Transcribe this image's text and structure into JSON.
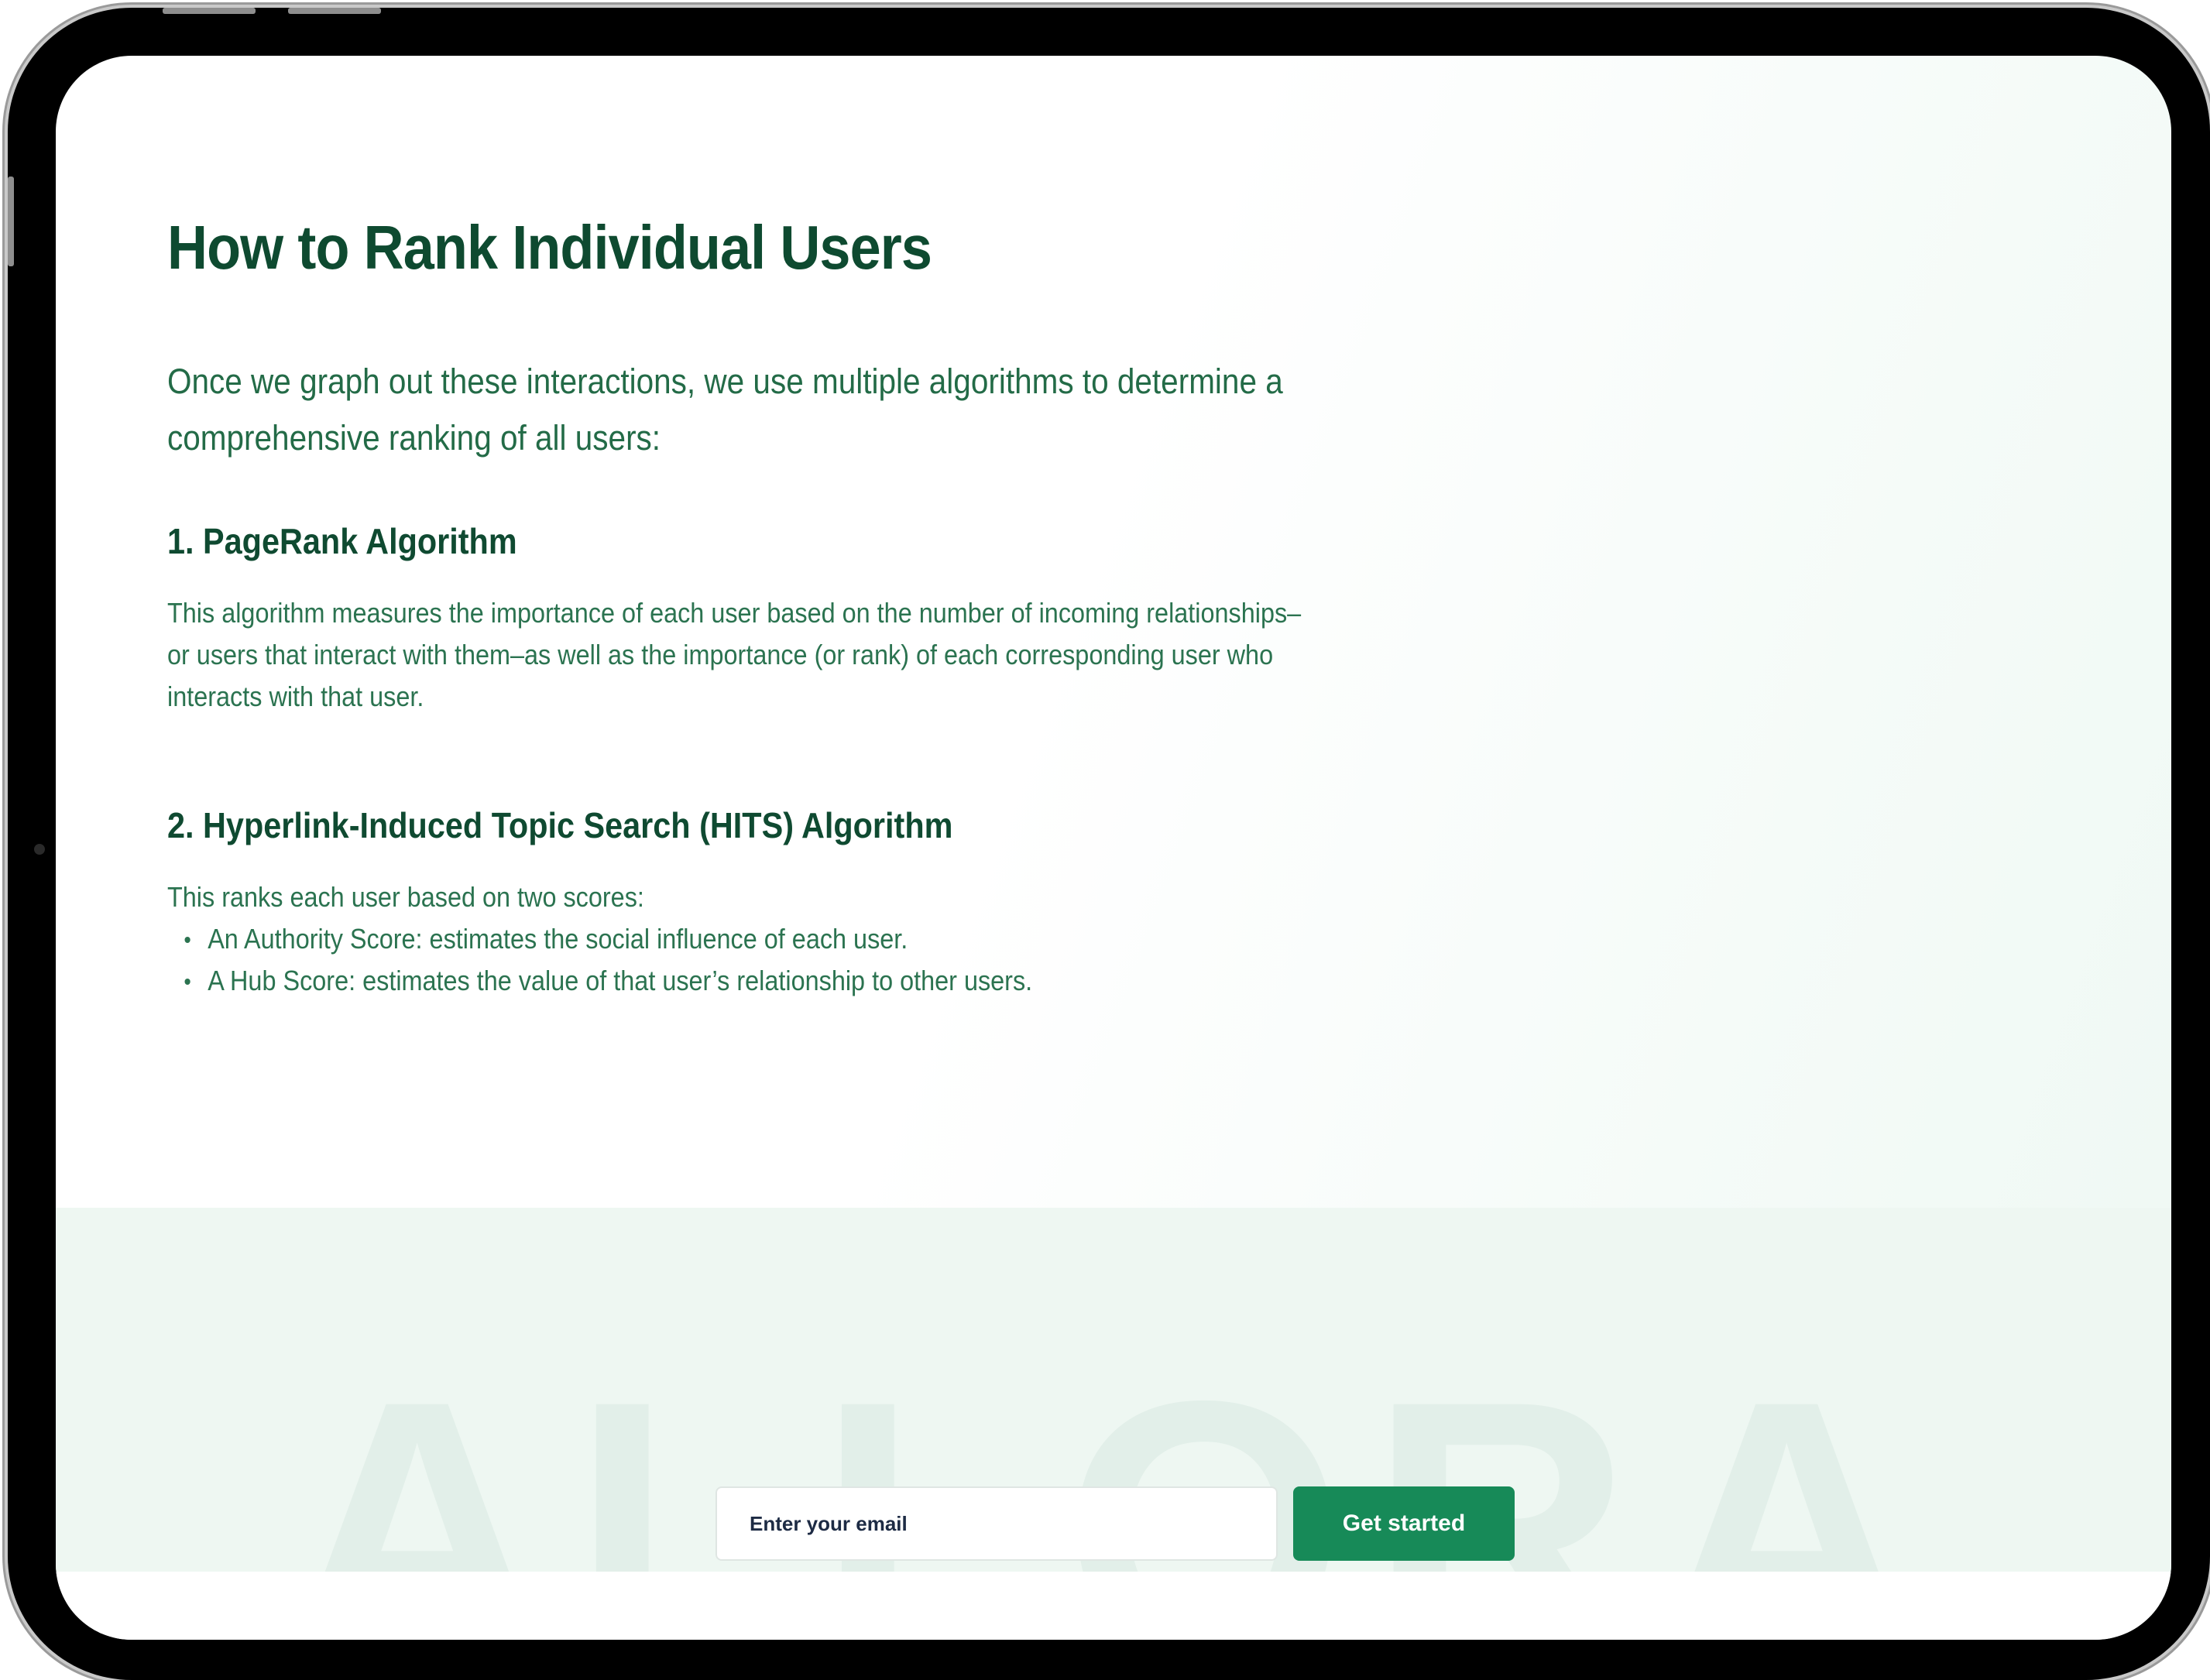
{
  "page": {
    "title": "How to Rank Individual Users",
    "lead": "Once we graph out these interactions, we use multiple algorithms to determine a comprehensive ranking of all users:"
  },
  "sections": [
    {
      "title": "1. PageRank Algorithm",
      "body": "This algorithm measures the importance of each user based on the number of incoming relationships–or users that interact with them–as well as the importance (or rank) of each corresponding user who interacts with that user."
    },
    {
      "title": "2. Hyperlink-Induced Topic Search (HITS) Algorithm",
      "intro": "This ranks each user based on two scores:",
      "bullets": [
        "An Authority Score: estimates the social influence of each user.",
        "A Hub Score: estimates the value of that user’s relationship to other users."
      ]
    }
  ],
  "footer": {
    "watermark": "ALLORA",
    "email_placeholder": "Enter your email",
    "cta_label": "Get started"
  },
  "colors": {
    "heading": "#0e4a30",
    "body": "#2b7350",
    "cta": "#178a58",
    "footer_bg": "#eef7f2"
  }
}
